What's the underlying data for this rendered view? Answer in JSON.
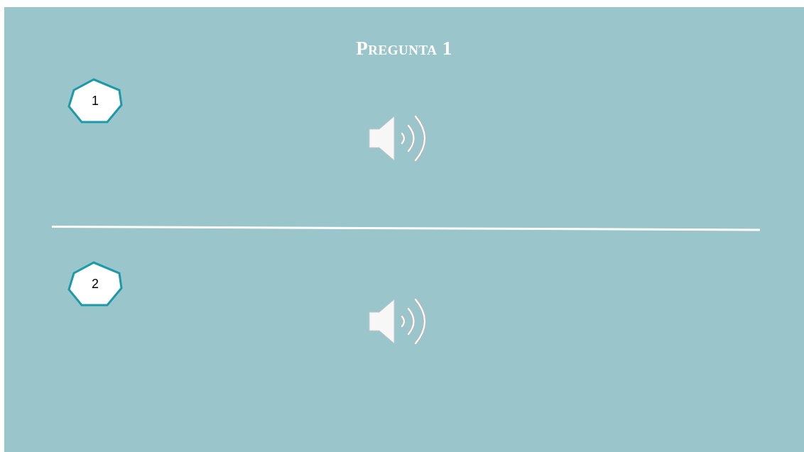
{
  "title": "Pregunta 1",
  "items": [
    {
      "number": "1"
    },
    {
      "number": "2"
    }
  ]
}
